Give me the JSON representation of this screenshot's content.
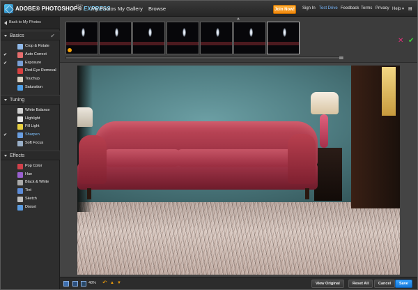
{
  "header": {
    "logo_text_1": "ADOBE® PHOTOSHOP®",
    "logo_text_2": "EXPRESS",
    "beta": "BETA",
    "nav": [
      "My Photos",
      "My Gallery",
      "Browse"
    ],
    "join_label": "Join Now!",
    "links": [
      "Sign In",
      "Test Drive",
      "Feedback",
      "Terms",
      "Privacy",
      "Help"
    ],
    "active_link": "Test Drive"
  },
  "sidebar": {
    "back_label": "Back to My Photos",
    "sections": [
      {
        "label": "Basics",
        "items": [
          {
            "label": "Crop & Rotate",
            "icon": "crop-icon",
            "color": "#8fb8e8"
          },
          {
            "label": "Auto Correct",
            "icon": "wand-icon",
            "color": "#e56d6d",
            "checked": true
          },
          {
            "label": "Exposure",
            "icon": "exposure-icon",
            "color": "#7aa0d6",
            "checked": true
          },
          {
            "label": "Red-Eye Removal",
            "icon": "eye-icon",
            "color": "#d94040"
          },
          {
            "label": "Touchup",
            "icon": "bandage-icon",
            "color": "#dcd4c4"
          },
          {
            "label": "Saturation",
            "icon": "saturation-icon",
            "color": "#4fa0e8"
          }
        ]
      },
      {
        "label": "Tuning",
        "items": [
          {
            "label": "White Balance",
            "icon": "balance-icon",
            "color": "#cfcfcf"
          },
          {
            "label": "Highlight",
            "icon": "highlight-icon",
            "color": "#e8e8e8"
          },
          {
            "label": "Fill Light",
            "icon": "bulb-icon",
            "color": "#e8d040"
          },
          {
            "label": "Sharpen",
            "icon": "sharpen-icon",
            "color": "#6a9ee0",
            "checked": true,
            "active": true
          },
          {
            "label": "Soft Focus",
            "icon": "softfocus-icon",
            "color": "#9ab0c8"
          }
        ]
      },
      {
        "label": "Effects",
        "items": [
          {
            "label": "Pop Color",
            "icon": "popcolor-icon",
            "color": "#d0404a"
          },
          {
            "label": "Hue",
            "icon": "hue-icon",
            "color": "#9a60d0"
          },
          {
            "label": "Black & White",
            "icon": "bw-icon",
            "color": "#aaaaaa"
          },
          {
            "label": "Tint",
            "icon": "tint-icon",
            "color": "#5c8bd8"
          },
          {
            "label": "Sketch",
            "icon": "sketch-icon",
            "color": "#c0c0c0"
          },
          {
            "label": "Distort",
            "icon": "distort-icon",
            "color": "#5a9be0"
          }
        ]
      }
    ]
  },
  "toolbar": {
    "zoom": "48%",
    "view_original": "View Original",
    "reset_all": "Reset All",
    "cancel": "Cancel",
    "save": "Save"
  },
  "colors": {
    "accent": "#2a8cf0",
    "join": "#f4931a",
    "confirm": "#3bd33b",
    "reject": "#e0307a"
  }
}
